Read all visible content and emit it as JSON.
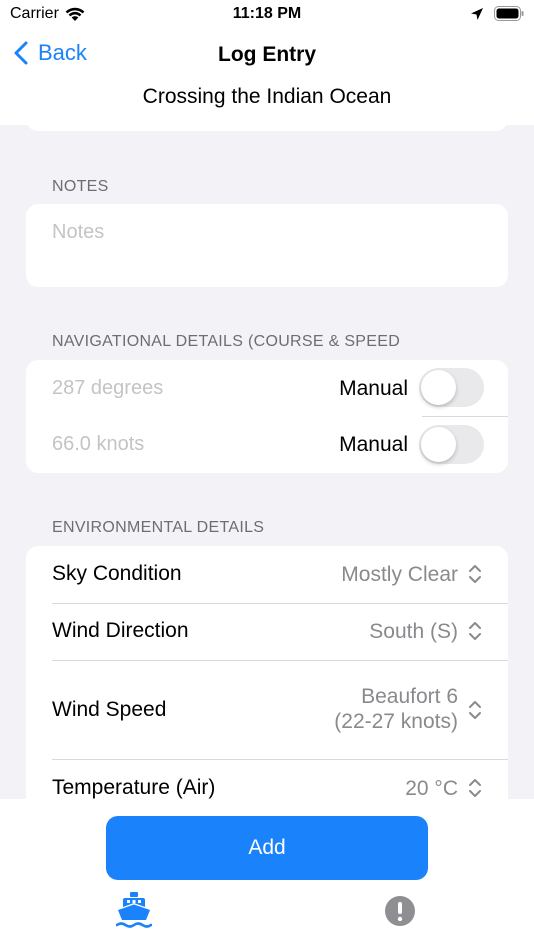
{
  "status_bar": {
    "carrier": "Carrier",
    "time": "11:18 PM"
  },
  "nav": {
    "back_label": "Back",
    "title": "Log Entry",
    "subtitle": "Crossing the Indian Ocean"
  },
  "notes": {
    "header": "NOTES",
    "placeholder": "Notes"
  },
  "navigation": {
    "header": "NAVIGATIONAL DETAILS (COURSE & SPEED",
    "course_placeholder": "287 degrees",
    "speed_placeholder": "66.0 knots",
    "manual_label": "Manual",
    "course_manual": false,
    "speed_manual": false
  },
  "environment": {
    "header": "ENVIRONMENTAL DETAILS",
    "rows": [
      {
        "label": "Sky Condition",
        "value": "Mostly Clear"
      },
      {
        "label": "Wind Direction",
        "value": "South (S)"
      },
      {
        "label": "Wind Speed",
        "value_line1": "Beaufort 6",
        "value_line2": "(22-27 knots)"
      },
      {
        "label": "Temperature (Air)",
        "value": "20 °C"
      }
    ]
  },
  "actions": {
    "add_label": "Add"
  },
  "colors": {
    "accent": "#1a82fb",
    "group_bg": "#f2f2f7",
    "tab_inactive": "#8e8e93"
  },
  "tabs": [
    {
      "icon": "ship-icon",
      "selected": true
    },
    {
      "icon": "exclamation-circle-icon",
      "selected": false
    }
  ]
}
